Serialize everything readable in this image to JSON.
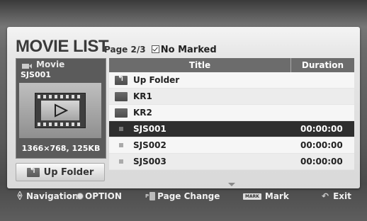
{
  "header": {
    "title": "MOVIE LIST",
    "page_info": "Page 2/3",
    "marked_status": "No Marked"
  },
  "preview": {
    "category": "Movie",
    "file_name": "SJS001",
    "resolution_size": "1366×768, 125KB"
  },
  "up_folder_button": "Up Folder",
  "table": {
    "columns": [
      "Title",
      "Duration"
    ],
    "rows": [
      {
        "icon": "up-folder-icon",
        "title": "Up Folder",
        "duration": ""
      },
      {
        "icon": "folder-icon",
        "title": "KR1",
        "duration": ""
      },
      {
        "icon": "folder-icon",
        "title": "KR2",
        "duration": ""
      },
      {
        "icon": "file-icon",
        "title": "SJS001",
        "duration": "00:00:00",
        "selected": true
      },
      {
        "icon": "file-icon",
        "title": "SJS002",
        "duration": "00:00:00"
      },
      {
        "icon": "file-icon",
        "title": "SJS003",
        "duration": "00:00:00"
      }
    ]
  },
  "footer": {
    "navigation": "Navigation",
    "option": "OPTION",
    "page_change": "Page Change",
    "mark_key": "MARK",
    "mark": "Mark",
    "exit": "Exit"
  }
}
